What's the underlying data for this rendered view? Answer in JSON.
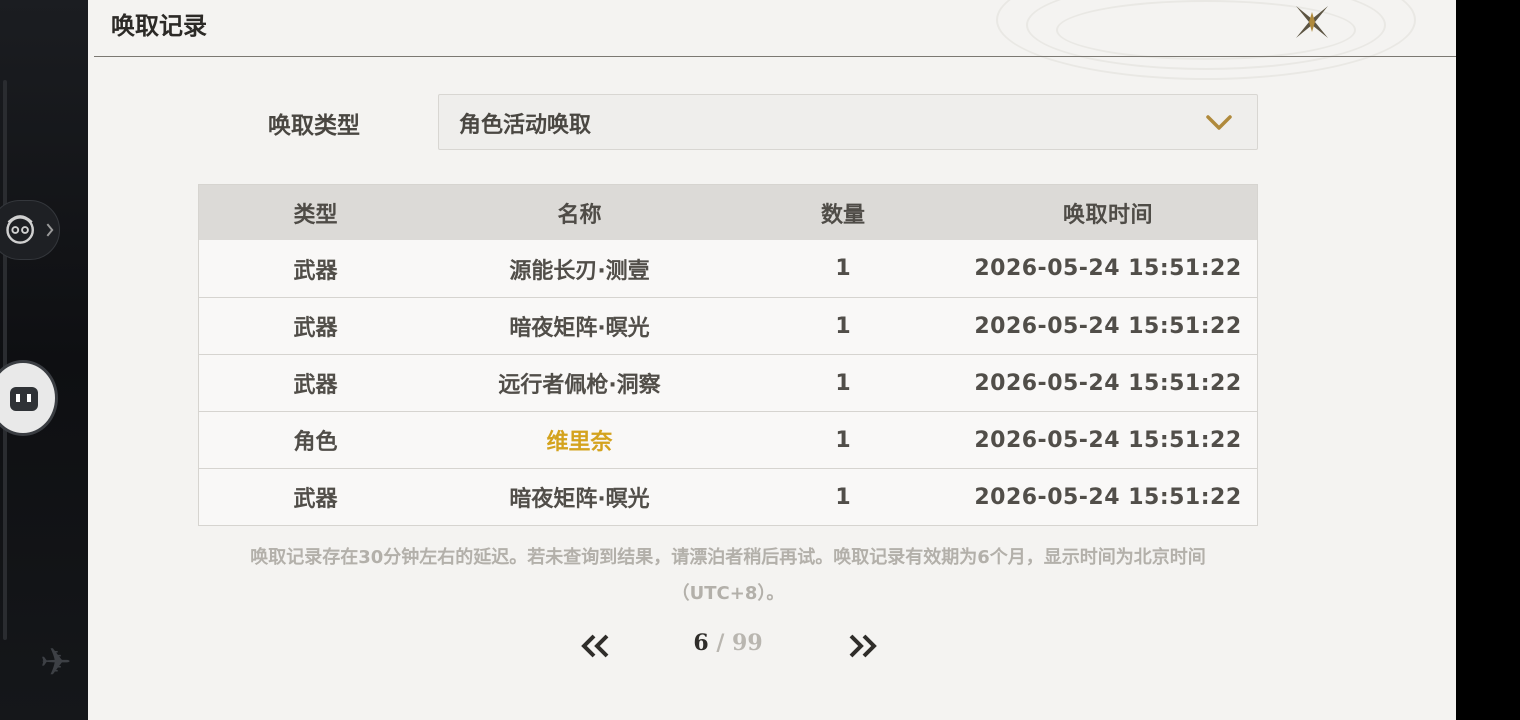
{
  "header": {
    "title": "唤取记录"
  },
  "filter": {
    "label": "唤取类型",
    "selected": "角色活动唤取"
  },
  "table": {
    "columns": [
      "类型",
      "名称",
      "数量",
      "唤取时间"
    ],
    "rows": [
      {
        "type": "武器",
        "name": "源能长刃·测壹",
        "count": "1",
        "time": "2026-05-24 15:51:22",
        "highlight": false
      },
      {
        "type": "武器",
        "name": "暗夜矩阵·暝光",
        "count": "1",
        "time": "2026-05-24 15:51:22",
        "highlight": false
      },
      {
        "type": "武器",
        "name": "远行者佩枪·洞察",
        "count": "1",
        "time": "2026-05-24 15:51:22",
        "highlight": false
      },
      {
        "type": "角色",
        "name": "维里奈",
        "count": "1",
        "time": "2026-05-24 15:51:22",
        "highlight": true
      },
      {
        "type": "武器",
        "name": "暗夜矩阵·暝光",
        "count": "1",
        "time": "2026-05-24 15:51:22",
        "highlight": false
      }
    ]
  },
  "note": "唤取记录存在30分钟左右的延迟。若未查询到结果，请漂泊者稍后再试。唤取记录有效期为6个月，显示时间为北京时间（UTC+8）。",
  "pagination": {
    "current": "6",
    "separator": "/",
    "total": "99"
  },
  "colors": {
    "highlight": "#d4a31e",
    "accent": "#b08a3c",
    "panel": "#f4f3f1"
  },
  "icons": {
    "close": "close-x-icon",
    "dropdown": "chevron-down-icon",
    "prev": "double-chevron-left-icon",
    "next": "double-chevron-right-icon"
  }
}
